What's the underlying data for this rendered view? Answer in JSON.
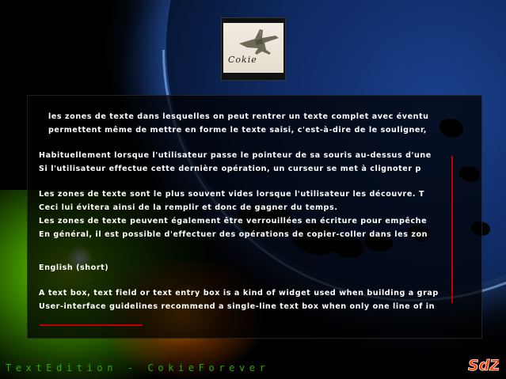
{
  "app": {
    "logo": {
      "text": "Cokie",
      "icon": "jet-plane-icon"
    },
    "footer_title": "TextEdition - CokieForever",
    "badge": "SdZ",
    "colors": {
      "scrollbar": "#c00000",
      "footer_text": "#2fa800",
      "badge": "#ff3300"
    }
  },
  "text_box": {
    "lines": [
      "les zones de texte dans lesquelles on peut rentrer un texte complet avec éventu",
      "permettent même de mettre en forme le texte saisi, c'est-à-dire de le souligner,",
      "Habituellement lorsque l'utilisateur passe le pointeur de sa souris au-dessus d'une",
      "Si l'utilisateur effectue cette dernière opération, un curseur se met à clignoter p",
      "Les zones de texte sont le plus souvent vides lorsque l'utilisateur les découvre. T",
      "Ceci lui évitera ainsi de la remplir et donc de gagner du temps.",
      "Les zones de texte peuvent également être verrouillées en écriture pour empêche",
      "En général, il est possible d'effectuer des opérations de copier-coller dans les zon",
      "English (short)",
      "A text box, text field or text entry box is a kind of widget used when building a grap",
      "User-interface guidelines recommend a single-line text box when only one line of in"
    ]
  }
}
